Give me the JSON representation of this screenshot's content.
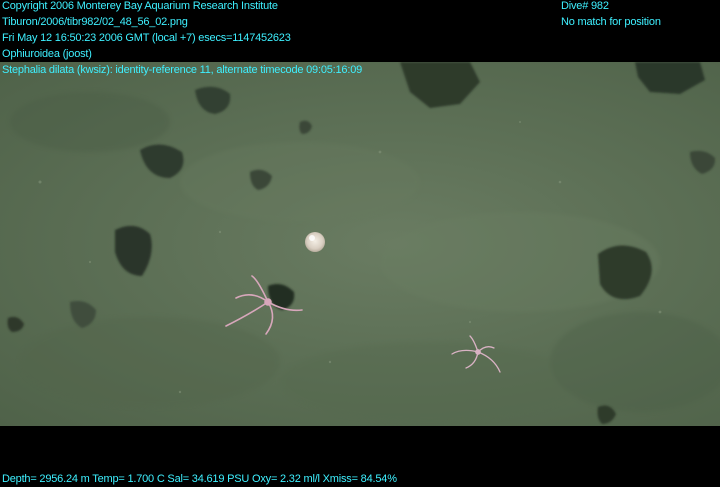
{
  "overlay": {
    "copyright": "Copyright 2006 Monterey Bay Aquarium Research Institute",
    "file_path": "Tiburon/2006/tibr982/02_48_56_02.png",
    "timestamp": "Fri May 12 16:50:23 2006 GMT (local +7)  esecs=1147452623",
    "concept": "Ophiuroidea (joost)",
    "identity": "Stephalia dilata (kwsiz): identity-reference 11, alternate timecode 09:05:16:09",
    "dive": "Dive# 982",
    "position": "No match for position",
    "telemetry": "Depth= 2956.24 m  Temp= 1.700 C  Sal= 34.619 PSU  Oxy= 2.32 ml/l  Xmiss= 84.54%"
  },
  "colors": {
    "overlay_text": "#3ef0ff",
    "seafloor": "#5d7056",
    "background": "#000000"
  }
}
